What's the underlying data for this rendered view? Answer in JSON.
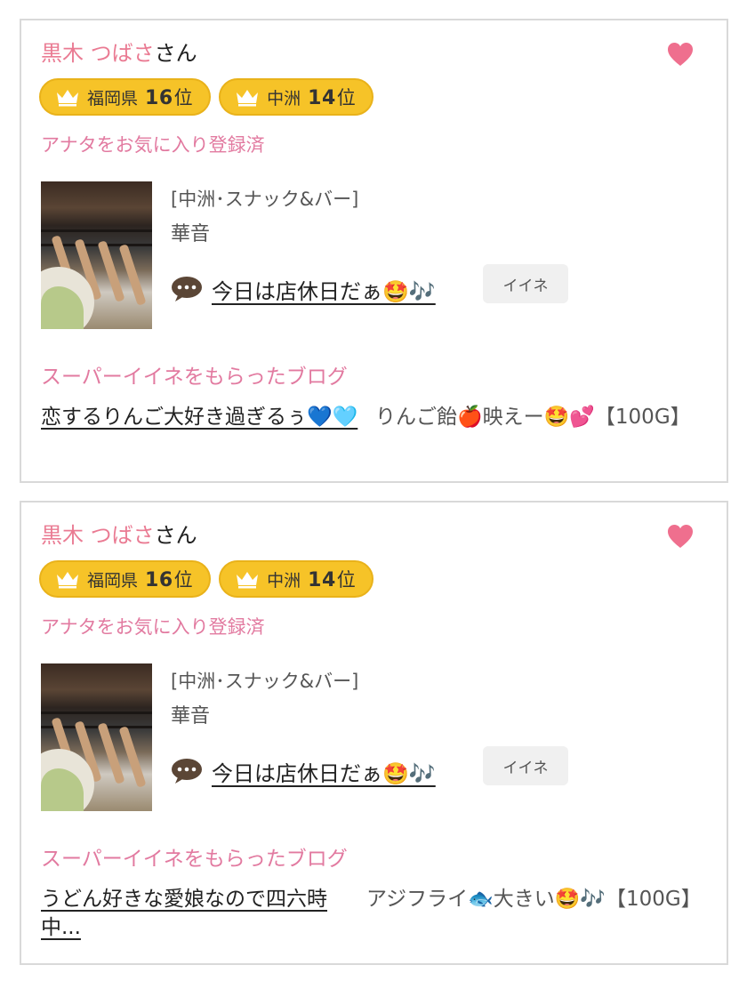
{
  "colors": {
    "accent_pink": "#ea7b93",
    "section_pink": "#e27aa0",
    "badge_gold": "#f6c328",
    "heart": "#ef6f8e"
  },
  "cards": [
    {
      "user_name": "黒木 つばさ",
      "honorific": "さん",
      "favorite_icon": "heart-icon",
      "badges": [
        {
          "icon": "crown-icon",
          "area": "福岡県",
          "rank": "16",
          "unit": "位"
        },
        {
          "icon": "crown-icon",
          "area": "中洲",
          "rank": "14",
          "unit": "位"
        }
      ],
      "favorite_status": "アナタをお気に入り登録済",
      "genre": "[中洲･スナック&バー]",
      "store": "華音",
      "message_icon": "speech-bubble-icon",
      "message": "今日は店休日だぁ🤩🎶",
      "like_label": "イイネ",
      "super_like_heading": "スーパーイイネをもらったブログ",
      "blog_title": "恋するりんご大好き過ぎるぅ💙🩵",
      "blog_desc": "りんご飴🍎映えー🤩💕【100G】"
    },
    {
      "user_name": "黒木 つばさ",
      "honorific": "さん",
      "favorite_icon": "heart-icon",
      "badges": [
        {
          "icon": "crown-icon",
          "area": "福岡県",
          "rank": "16",
          "unit": "位"
        },
        {
          "icon": "crown-icon",
          "area": "中洲",
          "rank": "14",
          "unit": "位"
        }
      ],
      "favorite_status": "アナタをお気に入り登録済",
      "genre": "[中洲･スナック&バー]",
      "store": "華音",
      "message_icon": "speech-bubble-icon",
      "message": "今日は店休日だぁ🤩🎶",
      "like_label": "イイネ",
      "super_like_heading": "スーパーイイネをもらったブログ",
      "blog_title": "うどん好きな愛娘なので四六時中...",
      "blog_desc": "アジフライ🐟大きい🤩🎶【100G】"
    }
  ]
}
